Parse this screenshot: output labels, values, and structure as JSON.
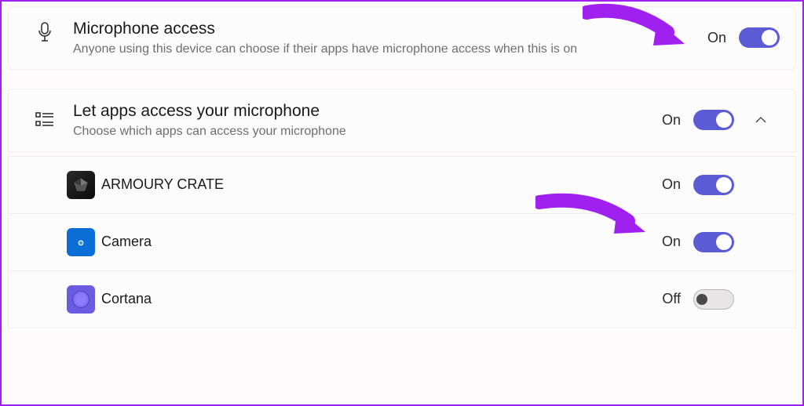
{
  "rows": {
    "micAccess": {
      "title": "Microphone access",
      "sub": "Anyone using this device can choose if their apps have microphone access when this is on",
      "status": "On",
      "on": true
    },
    "letApps": {
      "title": "Let apps access your microphone",
      "sub": "Choose which apps can access your microphone",
      "status": "On",
      "on": true,
      "expanded": true
    }
  },
  "apps": [
    {
      "name": "ARMOURY CRATE",
      "status": "On",
      "on": true,
      "iconKey": "armoury"
    },
    {
      "name": "Camera",
      "status": "On",
      "on": true,
      "iconKey": "camera"
    },
    {
      "name": "Cortana",
      "status": "Off",
      "on": false,
      "iconKey": "cortana"
    }
  ]
}
